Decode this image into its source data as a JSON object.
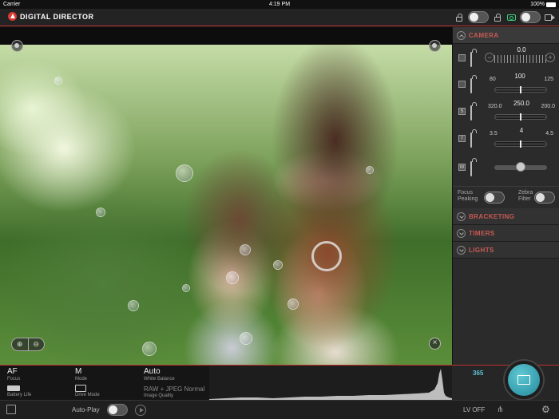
{
  "status_bar": {
    "carrier": "Carrier",
    "time": "4:19 PM",
    "battery": "100%"
  },
  "app": {
    "brand": "DIGITAL DIRECTOR",
    "accent": "#c0322e",
    "shoot_mode_icon": "camera-icon",
    "video_mode_icon": "video-icon"
  },
  "panel": {
    "camera_header": "CAMERA",
    "exposure_comp": {
      "value": "0.0"
    },
    "iso": {
      "left": "80",
      "value": "100",
      "right": "125"
    },
    "shutter": {
      "left": "320.0",
      "value": "250.0",
      "right": "200.0"
    },
    "aperture": {
      "left": "3.5",
      "value": "4",
      "right": "4.5"
    },
    "focus_peaking_label": "Focus Peaking",
    "zebra_filter_label": "Zebra Filter",
    "bracketing_header": "BRACKETING",
    "timers_header": "TIMERS",
    "lights_header": "LIGHTS"
  },
  "info": {
    "focus_value": "AF",
    "focus_label": "Focus",
    "mode_value": "M",
    "mode_label": "Mode",
    "wb_value": "Auto",
    "wb_label": "White Balance",
    "battery_label": "Battery Life",
    "drive_label": "Drive Mode",
    "quality_value": "RAW + JPEG Normal",
    "quality_label": "Image Quality"
  },
  "shots_remaining": "365",
  "bottom": {
    "autoplay_label": "Auto-Play",
    "lv_label": "LV OFF"
  }
}
